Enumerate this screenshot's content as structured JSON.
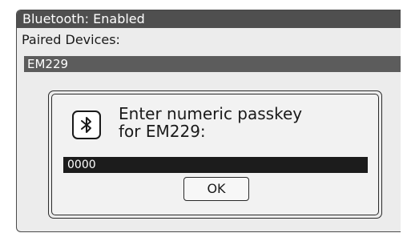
{
  "header": {
    "title": "Bluetooth: Enabled"
  },
  "device_list": {
    "label": "Paired Devices:",
    "selected_device": "EM229"
  },
  "passkey_dialog": {
    "icon": "bluetooth-icon",
    "message_line1": "Enter numeric passkey",
    "message_line2": "for EM229:",
    "passkey_value": "0000",
    "ok_label": "OK"
  },
  "colors": {
    "title_bar": "#4f4f4f",
    "selected_row": "#5c5c5c",
    "input_background": "#1c1c1c",
    "screen_background": "#ececec"
  }
}
